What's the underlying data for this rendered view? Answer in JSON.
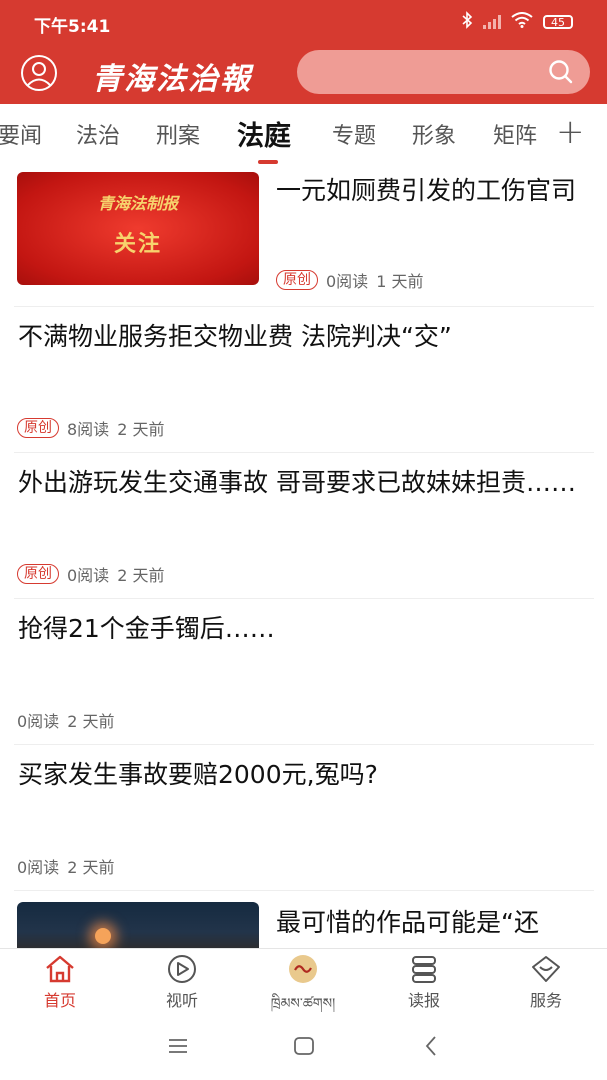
{
  "status_bar": {
    "time": "下午5:41",
    "battery": "45"
  },
  "header": {
    "logo_text": "青海法治報",
    "search_placeholder": ""
  },
  "tabs": [
    {
      "label": "要闻"
    },
    {
      "label": "法治"
    },
    {
      "label": "刑案"
    },
    {
      "label": "法庭",
      "active": true
    },
    {
      "label": "专题"
    },
    {
      "label": "形象"
    },
    {
      "label": "矩阵"
    }
  ],
  "tab_add": "+",
  "feed": [
    {
      "title": "一元如厕费引发的工伤官司",
      "badge": "原创",
      "reads": "0阅读",
      "time": "1 天前",
      "thumb_logo": "青海法制报",
      "thumb_text": "关注"
    },
    {
      "title": "不满物业服务拒交物业费 法院判决“交”",
      "badge": "原创",
      "reads": "8阅读",
      "time": "2 天前"
    },
    {
      "title": "外出游玩发生交通事故 哥哥要求已故妹妹担责……",
      "badge": "原创",
      "reads": "0阅读",
      "time": "2 天前"
    },
    {
      "title": "抢得21个金手镯后……",
      "reads": "0阅读",
      "time": "2 天前"
    },
    {
      "title": "买家发生事故要赔2000元,冤吗?",
      "reads": "0阅读",
      "time": "2 天前"
    },
    {
      "title": "最可惜的作品可能是“还"
    }
  ],
  "bottom_nav": [
    {
      "label": "首页",
      "icon": "home-icon",
      "active": true
    },
    {
      "label": "视听",
      "icon": "play-icon"
    },
    {
      "label": "ཁྲིམས་ཚགས།",
      "icon": "tibetan-logo-icon"
    },
    {
      "label": "读报",
      "icon": "newspaper-icon"
    },
    {
      "label": "服务",
      "icon": "service-icon"
    }
  ],
  "colors": {
    "brand": "#d63a30",
    "search_bg": "#ef9c95",
    "thumb_text": "#f7d36d"
  }
}
